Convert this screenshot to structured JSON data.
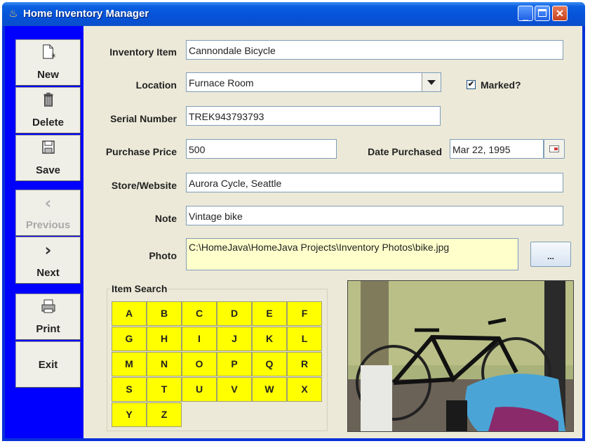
{
  "window": {
    "title": "Home Inventory Manager"
  },
  "toolbar": {
    "new_label": "New",
    "delete_label": "Delete",
    "save_label": "Save",
    "previous_label": "Previous",
    "next_label": "Next",
    "print_label": "Print",
    "exit_label": "Exit"
  },
  "form": {
    "inventory_item_label": "Inventory Item",
    "inventory_item_value": "Cannondale Bicycle",
    "location_label": "Location",
    "location_value": "Furnace Room",
    "marked_label": "Marked?",
    "marked_checked": true,
    "marked_check_glyph": "✔",
    "serial_number_label": "Serial Number",
    "serial_number_value": "TREK943793793",
    "purchase_price_label": "Purchase Price",
    "purchase_price_value": "500",
    "date_purchased_label": "Date Purchased",
    "date_purchased_value": "Mar 22, 1995",
    "store_label": "Store/Website",
    "store_value": "Aurora Cycle, Seattle",
    "note_label": "Note",
    "note_value": "Vintage bike",
    "photo_label": "Photo",
    "photo_value": "C:\\HomeJava\\HomeJava Projects\\Inventory Photos\\bike.jpg",
    "browse_label": "..."
  },
  "item_search": {
    "title": "Item Search",
    "letters": [
      "A",
      "B",
      "C",
      "D",
      "E",
      "F",
      "G",
      "H",
      "I",
      "J",
      "K",
      "L",
      "M",
      "N",
      "O",
      "P",
      "Q",
      "R",
      "S",
      "T",
      "U",
      "V",
      "W",
      "X",
      "Y",
      "Z"
    ]
  },
  "colors": {
    "toolbar_bg": "#0000ff",
    "letter_bg": "#ffff00",
    "photo_field_bg": "#ffffcc"
  }
}
